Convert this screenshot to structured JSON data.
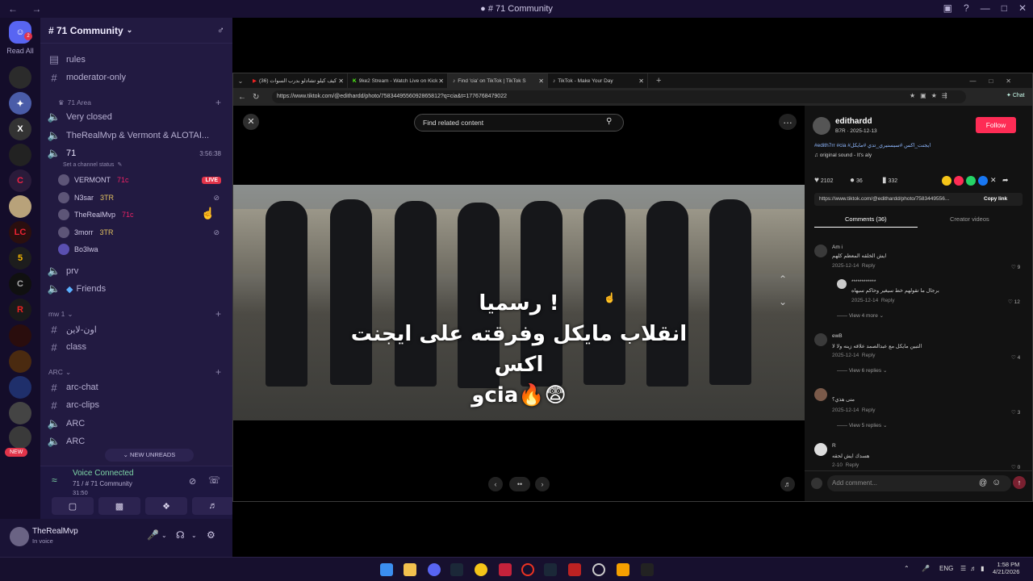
{
  "window": {
    "title": "# 71 Community"
  },
  "servers": {
    "read_all": "Read All",
    "badge": "2",
    "new_label": "NEW"
  },
  "channels": {
    "server_name": "# 71 Community",
    "items": {
      "rules": "rules",
      "moderator_only": "moderator-only",
      "cat_71_area": "71 Area",
      "very_closed": "Very closed",
      "therealmvp_vermont": "TheRealMvp & Vermont & ALOTAI...",
      "ch71": "71",
      "ch71_time": "3:56:38",
      "set_status": "Set a channel status",
      "prv": "prv",
      "friends": "Friends",
      "cat_mw1": "mw 1",
      "arabic_channel": "اون-لاين",
      "class": "class",
      "cat_arc": "ARC",
      "arc_chat": "arc-chat",
      "arc_clips": "arc-clips",
      "arc1": "ARC",
      "arc2": "ARC"
    },
    "voice_users": [
      {
        "name": "VERMONT",
        "tag": "71c"
      },
      {
        "name": "N3sar",
        "tag": "3TR"
      },
      {
        "name": "TheRealMvp",
        "tag": "71c"
      },
      {
        "name": "3morr",
        "tag": "3TR"
      },
      {
        "name": "Bo3lwa",
        "tag": ""
      }
    ],
    "live_label": "LIVE",
    "new_unreads": "NEW UNREADS"
  },
  "voice_panel": {
    "status": "Voice Connected",
    "channel": "71 / # 71 Community",
    "time": "31:50"
  },
  "user": {
    "name": "TheRealMvp",
    "status": "In voice"
  },
  "browser": {
    "tabs": [
      {
        "label": "كيف كيلو تشادلو بدرب السوات (36)"
      },
      {
        "label": "9ke2 Stream - Watch Live on Kick"
      },
      {
        "label": "Find 'cia' on TikTok | TikTok S"
      },
      {
        "label": "TikTok - Make Your Day"
      }
    ],
    "url": "https://www.tiktok.com/@edithardd/photo/7583449556092865812?q=cia&t=1776768479022",
    "chat_label": "Chat"
  },
  "tiktok": {
    "search_placeholder": "Find related content",
    "caption_lines": [
      "رسميا !",
      "انقلاب مايكل وفرقته على ايجنت",
      "اكس",
      "وcia🔥😨"
    ],
    "author": "edithardd",
    "author_sub": "B7R · 2025-12-13",
    "follow_label": "Follow",
    "description": "#edith7rr #cia #ايجنت_اكس #سيسنيري_تدي #مايكل",
    "sound": "original sound - It's aly",
    "likes": "2102",
    "comments_count": "36",
    "saves": "332",
    "share_url": "https://www.tiktok.com/@edithardd/photo/7583449556...",
    "copy_link": "Copy link",
    "tab_comments": "Comments (36)",
    "tab_creator": "Creator videos",
    "comments": [
      {
        "user": "Am i",
        "text": "ايش الخلقه المعظم كلهم",
        "date": "2025-12-14",
        "likes": "9"
      },
      {
        "user": "************",
        "text": "برجال ما تقولهم خط سيغير وحاكم سيهاه",
        "date": "2025-12-14",
        "likes": "12"
      },
      {
        "user": "ewB",
        "text": "التبين مايكل مع عبدالصمد علاقه زينه ولا لا",
        "date": "2025-12-14",
        "likes": "4"
      },
      {
        "user": "",
        "text": "متى هذي؟",
        "date": "2025-12-14",
        "likes": "3"
      },
      {
        "user": "R",
        "text": "هسدك ايش لحقه",
        "date": "2-10",
        "likes": "0"
      }
    ],
    "reply_label": "Reply",
    "view_more": "View 4 more",
    "view_6": "View 6 replies",
    "view_5": "View 5 replies",
    "add_comment": "Add comment..."
  },
  "taskbar": {
    "lang": "ENG",
    "time": "1:58 PM",
    "date": "4/21/2026"
  }
}
